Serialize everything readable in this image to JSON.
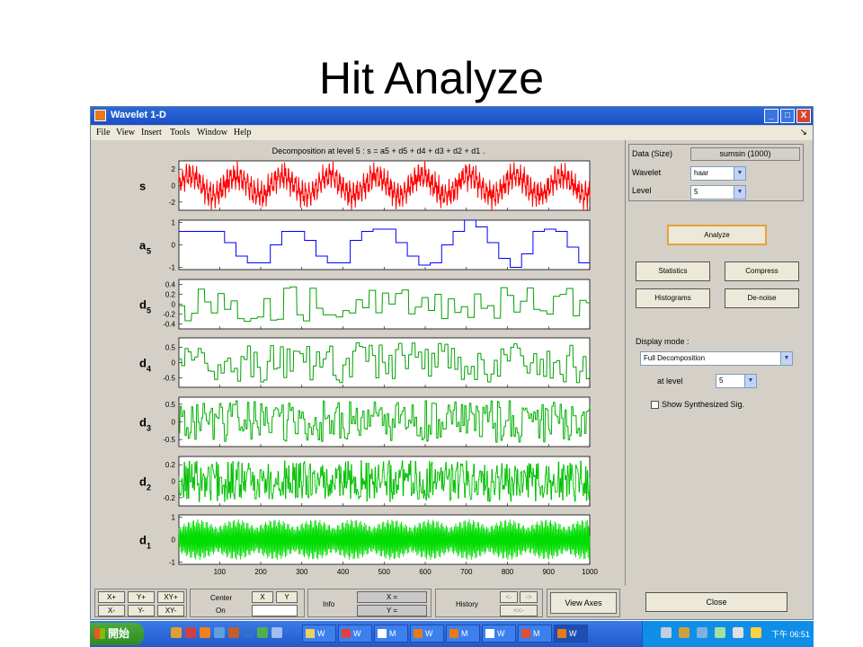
{
  "slide": {
    "title": "Hit Analyze"
  },
  "window": {
    "title": "Wavelet 1-D",
    "controls": [
      "_",
      "□",
      "X"
    ]
  },
  "menu": {
    "items": [
      "File",
      "View",
      "Insert",
      "Tools",
      "Window",
      "Help"
    ],
    "dock_arrow": "↘"
  },
  "plot": {
    "title": "Decomposition at level 5 : s = a5 + d5 + d4 + d3 + d2 + d1 ."
  },
  "chart_data": {
    "type": "line",
    "title": "Decomposition at level 5 : s = a5 + d5 + d4 + d3 + d2 + d1 .",
    "x_ticks": [
      100,
      200,
      300,
      400,
      500,
      600,
      700,
      800,
      900,
      1000
    ],
    "xlim": [
      1,
      1000
    ],
    "panels": [
      {
        "name": "s",
        "sub": "",
        "color": "#ff0000",
        "ylim": [
          -3,
          3
        ],
        "yticks": [
          "2",
          "0",
          "-2"
        ],
        "ytick_vals": [
          2,
          0,
          -2
        ]
      },
      {
        "name": "a",
        "sub": "5",
        "color": "#0000ff",
        "ylim": [
          -1.1,
          1.1
        ],
        "yticks": [
          "1",
          "0",
          "-1"
        ],
        "ytick_vals": [
          1,
          0,
          -1
        ],
        "values": [
          0.6,
          0.6,
          0.6,
          0.6,
          0.1,
          -0.5,
          -0.8,
          -0.8,
          0.0,
          0.6,
          0.6,
          0.2,
          -0.5,
          -0.8,
          -0.8,
          0.2,
          0.6,
          0.7,
          0.7,
          0.1,
          -0.5,
          -0.9,
          -0.8,
          0.0,
          0.6,
          1.1,
          0.8,
          0.1,
          -0.6,
          -1.0,
          -0.4,
          0.6,
          0.7,
          0.6,
          -0.1,
          -0.8
        ]
      },
      {
        "name": "d",
        "sub": "5",
        "color": "#00a000",
        "ylim": [
          -0.5,
          0.5
        ],
        "yticks": [
          "0.4",
          "0.2",
          "0",
          "-0.2",
          "-0.4"
        ],
        "ytick_vals": [
          0.4,
          0.2,
          0,
          -0.2,
          -0.4
        ]
      },
      {
        "name": "d",
        "sub": "4",
        "color": "#00a000",
        "ylim": [
          -0.8,
          0.8
        ],
        "yticks": [
          "0.5",
          "0",
          "-0.5"
        ],
        "ytick_vals": [
          0.5,
          0,
          -0.5
        ]
      },
      {
        "name": "d",
        "sub": "3",
        "color": "#00b000",
        "ylim": [
          -0.7,
          0.7
        ],
        "yticks": [
          "0.5",
          "0",
          "-0.5"
        ],
        "ytick_vals": [
          0.5,
          0,
          -0.5
        ]
      },
      {
        "name": "d",
        "sub": "2",
        "color": "#00c000",
        "ylim": [
          -0.3,
          0.3
        ],
        "yticks": [
          "0.2",
          "0",
          "-0.2"
        ],
        "ytick_vals": [
          0.2,
          0,
          -0.2
        ]
      },
      {
        "name": "d",
        "sub": "1",
        "color": "#00dd00",
        "ylim": [
          -1.1,
          1.1
        ],
        "yticks": [
          "1",
          "0",
          "-1"
        ],
        "ytick_vals": [
          1,
          0,
          -1
        ]
      }
    ]
  },
  "params": {
    "data_label": "Data  (Size)",
    "data_value": "sumsin  (1000)",
    "wavelet_label": "Wavelet",
    "wavelet_value": "haar",
    "level_label": "Level",
    "level_value": "5"
  },
  "actions": {
    "analyze": "Analyze",
    "statistics": "Statistics",
    "compress": "Compress",
    "histograms": "Histograms",
    "denoise": "De-noise"
  },
  "display": {
    "mode_label": "Display mode :",
    "mode_value": "Full Decomposition",
    "at_level_label": "at level",
    "at_level_value": "5",
    "show_synth": "Show Synthesized Sig."
  },
  "close_label": "Close",
  "toolbar": {
    "zoom": [
      "X+",
      "Y+",
      "XY+",
      "X-",
      "Y-",
      "XY-"
    ],
    "center_label": "Center",
    "center_x": "X",
    "center_y": "Y",
    "on_label": "On",
    "info_label": "Info",
    "x_eq": "X =",
    "y_eq": "Y =",
    "history_label": "History",
    "hist_back": "<-",
    "hist_fwd": "->",
    "hist_start": "<<-",
    "view_axes": "View Axes"
  },
  "taskbar": {
    "start_label": "開始",
    "tasks": [
      "W",
      "W",
      "M",
      "W",
      "M",
      "W",
      "M",
      "W"
    ],
    "clock": "下午 06:51"
  }
}
